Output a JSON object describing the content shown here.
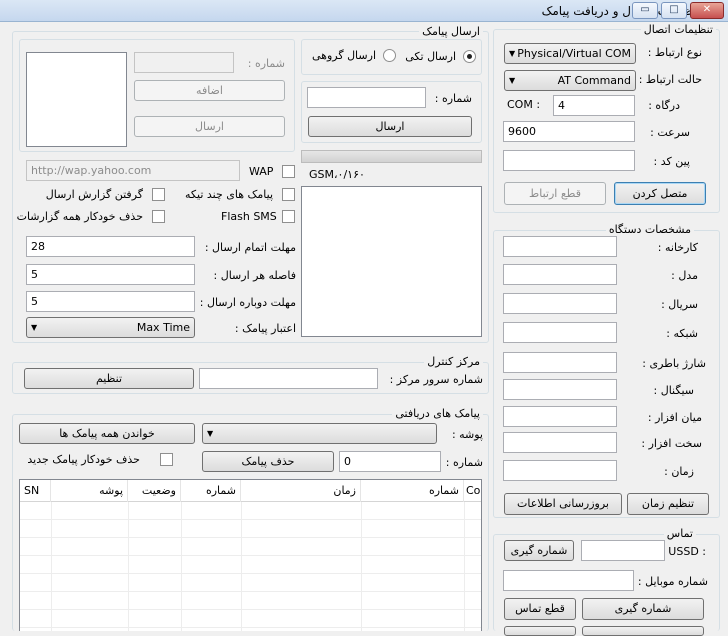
{
  "window": {
    "title": "تنظیمات ارسال و دریافت پیامک",
    "minimize": "▭",
    "maximize": "□",
    "close": "✕"
  },
  "connection": {
    "group_title": "تنظیمات اتصال",
    "type_label": "نوع ارتباط :",
    "type_value": "Physical/Virtual COM",
    "mode_label": "حالت ارتباط :",
    "mode_value": "AT Command",
    "port_label": "درگاه :",
    "port_prefix": "COM :",
    "port_value": "4",
    "speed_label": "سرعت :",
    "speed_value": "9600",
    "pin_label": "پین کد :",
    "pin_value": "",
    "connect_button": "متصل کردن",
    "disconnect_button": "قطع ارتباط"
  },
  "device": {
    "group_title": "مشخصات دستگاه",
    "manufacturer_label": "کارخانه :",
    "model_label": "مدل :",
    "serial_label": "سریال :",
    "network_label": "شبکه :",
    "battery_label": "شارژ باطری :",
    "signal_label": "سیگنال :",
    "firmware_label": "میان افزار :",
    "hardware_label": "سخت افزار :",
    "time_label": "زمان :",
    "set_time_button": "تنظیم زمان",
    "update_info_button": "بروزرسانی اطلاعات"
  },
  "call": {
    "group_title": "تماس",
    "ussd_label": "USSD :",
    "ussd_dial_button": "شماره گیری",
    "mobile_label": "شماره موبایل :",
    "dial_button": "شماره گیری",
    "hangup_button": "قطع تماس"
  },
  "send": {
    "group_title": "ارسال پیامک",
    "single_label": "ارسال تکی",
    "group_label": "ارسال گروهی",
    "number_label": "شماره :",
    "number_value": "",
    "send_button": "ارسال",
    "status_text": "GSM،۰/۱۶۰",
    "group_number_label": "شماره :",
    "add_button": "اضافه",
    "group_send_button": "ارسال",
    "wap_label": "WAP",
    "wap_url": "http://wap.yahoo.com",
    "multipart_label": "پیامک های چند تیکه",
    "delivery_report_label": "گرفتن گزارش ارسال",
    "flash_label": "Flash SMS",
    "auto_delete_reports_label": "حذف خودکار همه گزارشات",
    "send_timeout_label": "مهلت اتمام ارسال :",
    "send_timeout_value": "28",
    "send_interval_label": "فاصله هر ارسال :",
    "send_interval_value": "5",
    "resend_timeout_label": "مهلت دوباره ارسال :",
    "resend_timeout_value": "5",
    "validity_label": "اعتبار پیامک :",
    "validity_value": "Max Time"
  },
  "control_center": {
    "group_title": "مرکز کنترل",
    "server_label": "شماره سرور مرکز :",
    "server_value": "",
    "set_button": "تنظیم"
  },
  "inbox": {
    "group_title": "پیامک های دریافتی",
    "folder_label": "پوشه :",
    "folder_value": "",
    "read_all_button": "خواندن همه پیامک ها",
    "number_label": "شماره :",
    "number_value": "0",
    "delete_button": "حذف پیامک",
    "auto_delete_label": "حذف خودکار پیامک جدید",
    "columns": [
      "Co",
      "شماره",
      "زمان",
      "شماره",
      "وضعیت",
      "پوشه",
      "SN"
    ]
  }
}
